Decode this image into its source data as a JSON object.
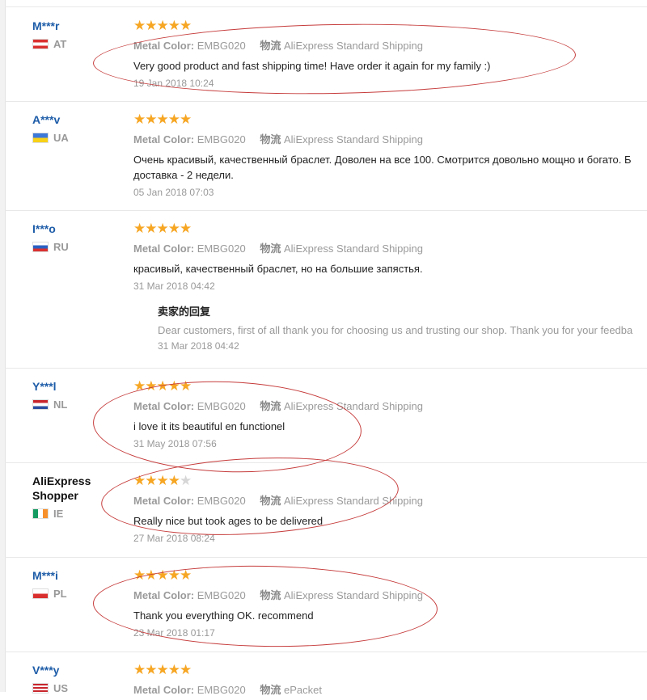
{
  "reviews": [
    {
      "user": "M***r",
      "country": "AT",
      "stars": 5,
      "metal_label": "Metal Color:",
      "metal_value": "EMBG020",
      "ship_label": "物流",
      "ship_value": "AliExpress Standard Shipping",
      "text": "Very good product and fast shipping time! Have order it again for my family :)",
      "date": "19 Jan 2018 10:24"
    },
    {
      "user": "A***v",
      "country": "UA",
      "stars": 5,
      "metal_label": "Metal Color:",
      "metal_value": "EMBG020",
      "ship_label": "物流",
      "ship_value": "AliExpress Standard Shipping",
      "text": "Очень красивый, качественный браслет. Доволен на все 100. Смотрится довольно мощно и богато. Б",
      "text2": "доставка - 2 недели.",
      "date": "05 Jan 2018 07:03"
    },
    {
      "user": "I***o",
      "country": "RU",
      "stars": 5,
      "metal_label": "Metal Color:",
      "metal_value": "EMBG020",
      "ship_label": "物流",
      "ship_value": "AliExpress Standard Shipping",
      "text": "красивый, качественный браслет, но на большие запястья.",
      "date": "31 Mar 2018 04:42",
      "reply_title": "卖家的回复",
      "reply_text": "Dear customers, first of all thank you for choosing us and trusting our shop. Thank you for your feedba",
      "reply_date": "31 Mar 2018 04:42"
    },
    {
      "user": "Y***l",
      "country": "NL",
      "stars": 5,
      "metal_label": "Metal Color:",
      "metal_value": "EMBG020",
      "ship_label": "物流",
      "ship_value": "AliExpress Standard Shipping",
      "text": "i love it its beautiful en functionel",
      "date": "31 May 2018 07:56"
    },
    {
      "user": "AliExpress Shopper",
      "country": "IE",
      "stars": 4,
      "metal_label": "Metal Color:",
      "metal_value": "EMBG020",
      "ship_label": "物流",
      "ship_value": "AliExpress Standard Shipping",
      "text": "Really nice but took ages to be delivered",
      "date": "27 Mar 2018 08:24"
    },
    {
      "user": "M***i",
      "country": "PL",
      "stars": 5,
      "metal_label": "Metal Color:",
      "metal_value": "EMBG020",
      "ship_label": "物流",
      "ship_value": "AliExpress Standard Shipping",
      "text": "Thank you everything OK. recommend",
      "date": "23 Mar 2018 01:17"
    },
    {
      "user": "V***y",
      "country": "US",
      "stars": 5,
      "metal_label": "Metal Color:",
      "metal_value": "EMBG020",
      "ship_label": "物流",
      "ship_value": "ePacket"
    }
  ],
  "colors": {
    "star": "#f6a623",
    "username": "#1d5ca8",
    "annotation": "#c63b3b"
  }
}
